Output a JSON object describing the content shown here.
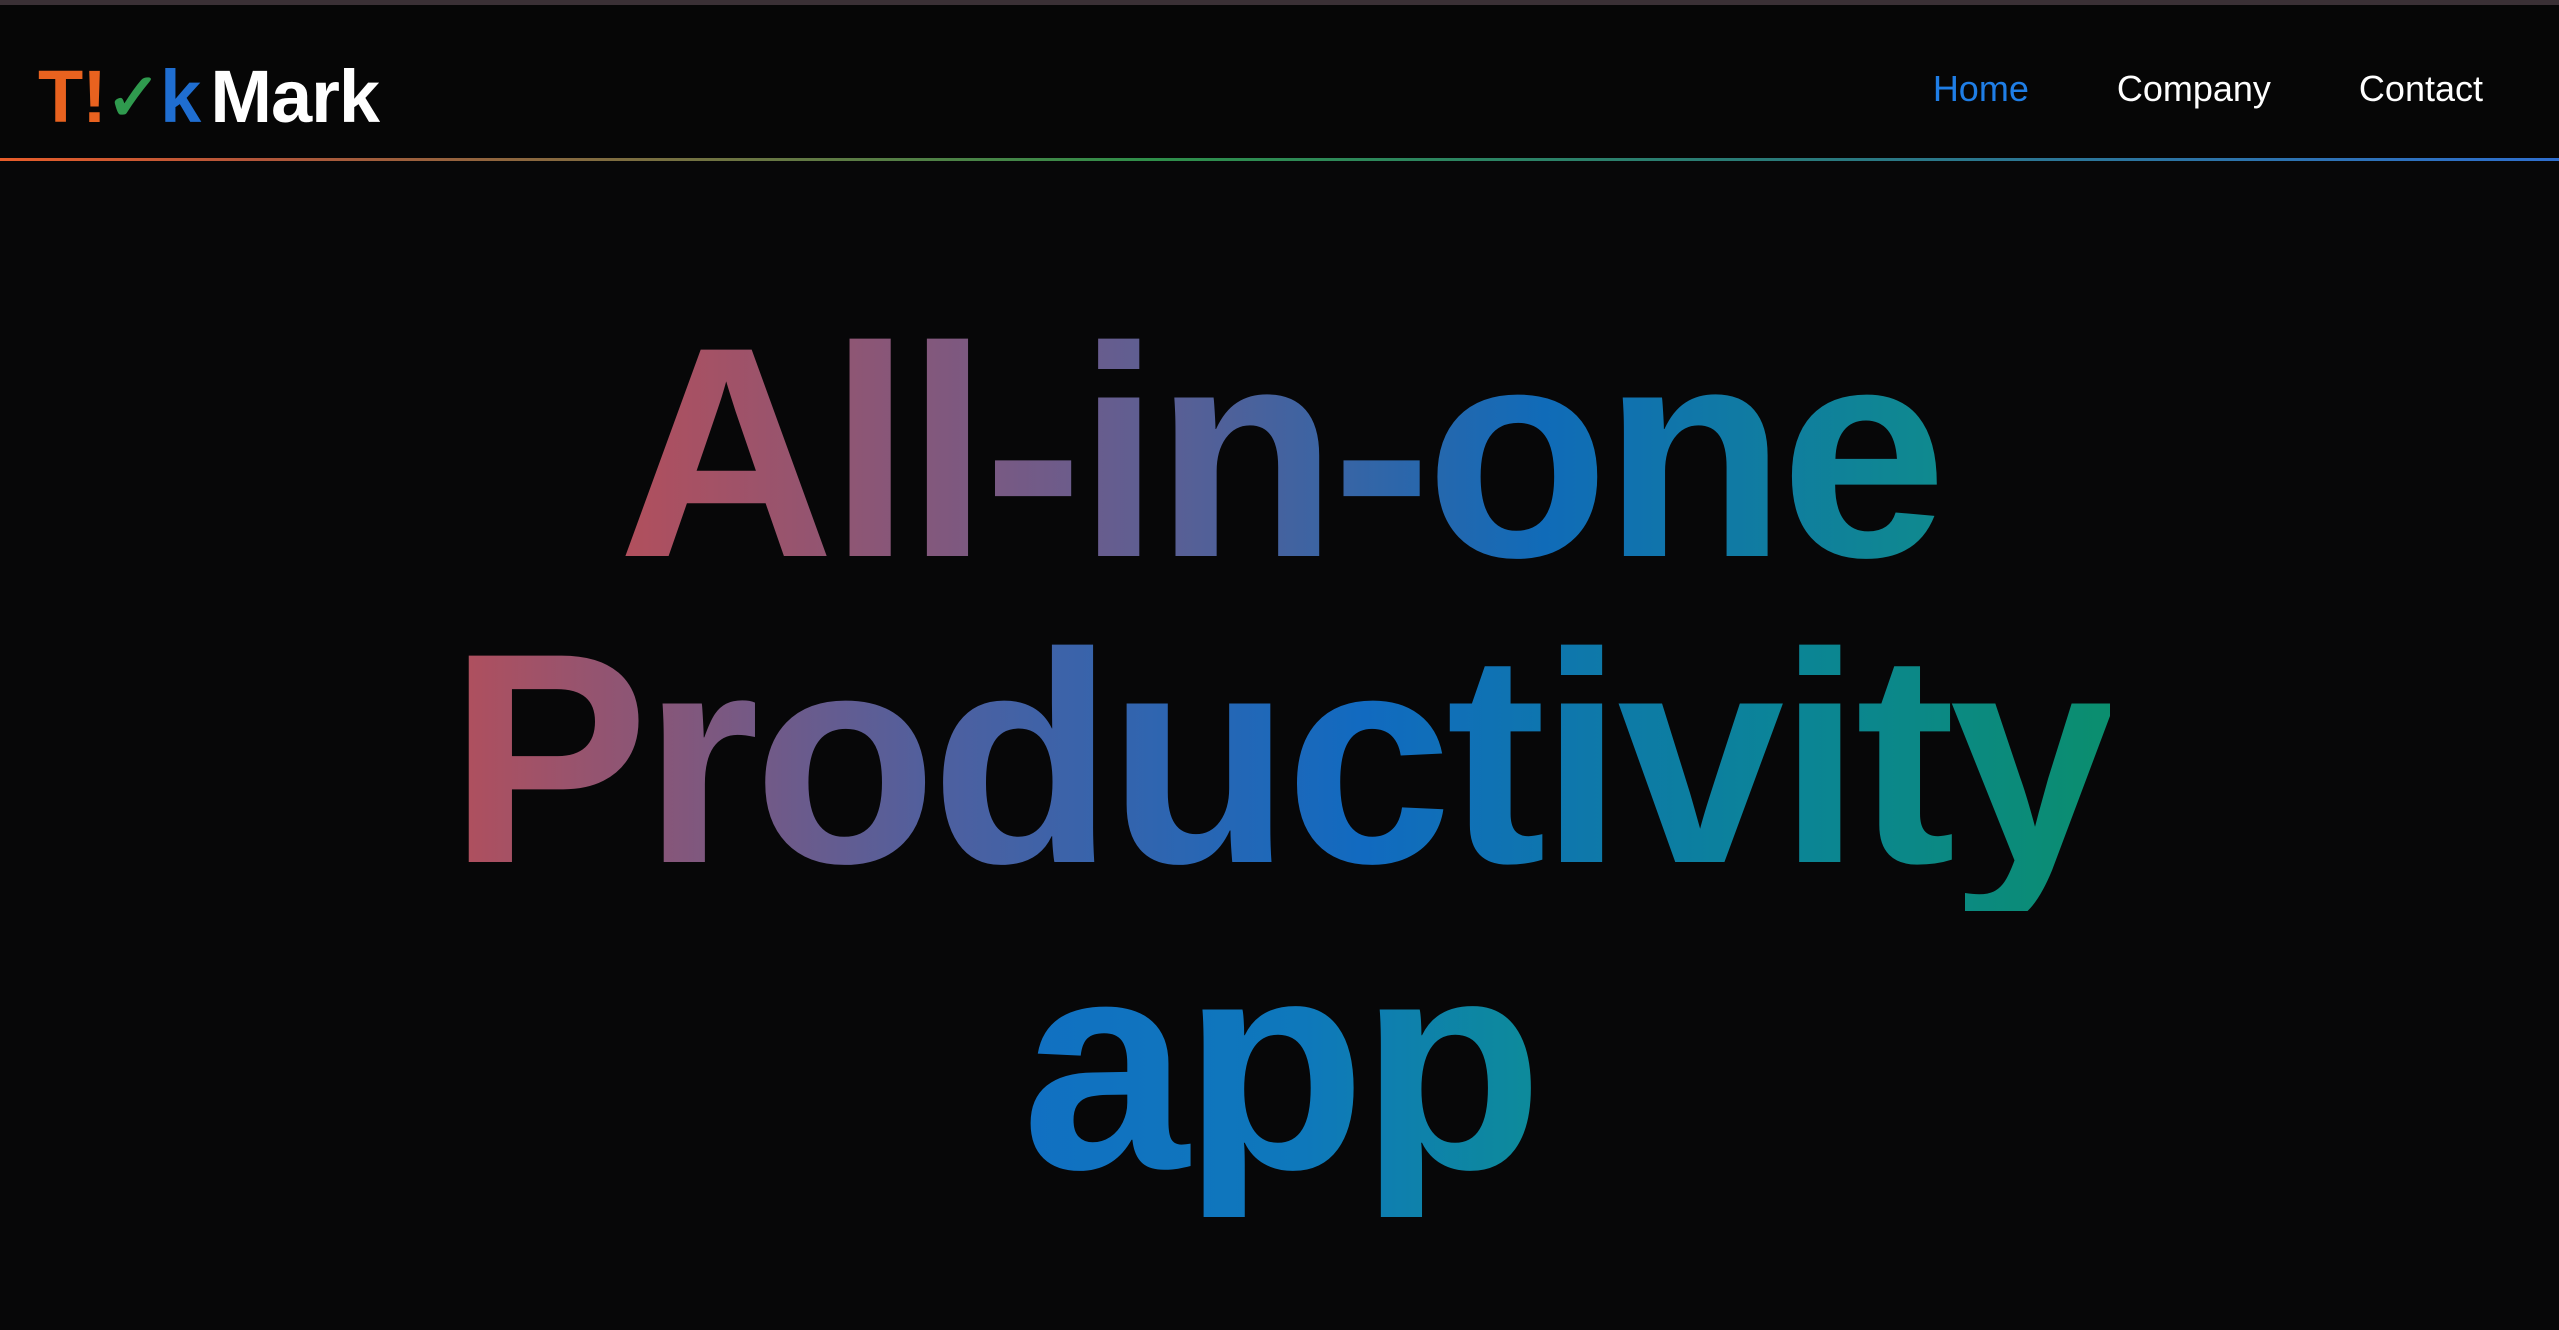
{
  "header": {
    "logo": {
      "t": "T",
      "bang": "!",
      "check": "✓",
      "k": "k",
      "mark": "Mark"
    },
    "nav": [
      {
        "label": "Home",
        "active": true
      },
      {
        "label": "Company",
        "active": false
      },
      {
        "label": "Contact",
        "active": false
      }
    ]
  },
  "hero": {
    "lines": [
      "All-in-one",
      "Productivity",
      "app"
    ]
  },
  "colors": {
    "background": "#070708",
    "active_nav": "#1f7ee6",
    "logo_orange": "#e8621f",
    "logo_green": "#2f9a4e",
    "logo_blue": "#1f6ed1",
    "gradient_rose": "#b24f5c",
    "gradient_blue": "#106bb8",
    "gradient_teal": "#0b8e6e"
  }
}
